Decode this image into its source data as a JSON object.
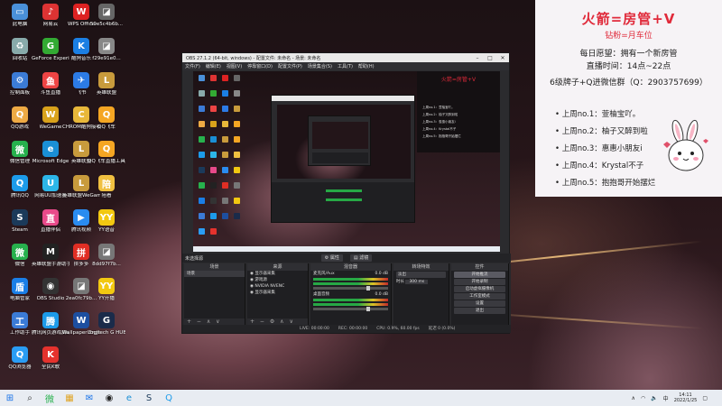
{
  "desktop": {
    "icons": [
      {
        "label": "此电脑",
        "icon": "computer-icon",
        "color": "#4a90d9",
        "glyph": "▭"
      },
      {
        "label": "网易云",
        "icon": "netease-icon",
        "color": "#d33",
        "glyph": "♪"
      },
      {
        "label": "WPS Office",
        "icon": "wps-icon",
        "color": "#d22",
        "glyph": "W"
      },
      {
        "label": "59e5c4b6b...",
        "icon": "file-icon",
        "color": "#666",
        "glyph": "◪"
      },
      {
        "label": "回收站",
        "icon": "recycle-bin-icon",
        "color": "#8aa",
        "glyph": "♻"
      },
      {
        "label": "GeForce Experience",
        "icon": "geforce-icon",
        "color": "#3a3",
        "glyph": "G"
      },
      {
        "label": "酷狗音乐",
        "icon": "kugou-icon",
        "color": "#1b7fe3",
        "glyph": "K"
      },
      {
        "label": "f29e91e0...",
        "icon": "file-icon",
        "color": "#888",
        "glyph": "◪"
      },
      {
        "label": "控制面板",
        "icon": "control-panel-icon",
        "color": "#3b7bd6",
        "glyph": "⚙"
      },
      {
        "label": "斗鱼直播",
        "icon": "douyu-icon",
        "color": "#e44",
        "glyph": "鱼"
      },
      {
        "label": "飞书",
        "icon": "feishu-icon",
        "color": "#2c7be5",
        "glyph": "✈"
      },
      {
        "label": "英雄联盟",
        "icon": "lol-icon",
        "color": "#c89b3c",
        "glyph": "L"
      },
      {
        "label": "QQ游戏",
        "icon": "qqgame-icon",
        "color": "#ea4",
        "glyph": "Q"
      },
      {
        "label": "WeGame",
        "icon": "wegame-icon",
        "color": "#d9a21b",
        "glyph": "W"
      },
      {
        "label": "CHROM酷狗接收工",
        "icon": "app-icon",
        "color": "#e8b83a",
        "glyph": "C"
      },
      {
        "label": "QQ飞车",
        "icon": "qqspeed-icon",
        "color": "#f5a623",
        "glyph": "Q"
      },
      {
        "label": "微信管理",
        "icon": "wechat-icon",
        "color": "#27b14d",
        "glyph": "微"
      },
      {
        "label": "Microsoft Edge",
        "icon": "edge-icon",
        "color": "#1a8fd6",
        "glyph": "e"
      },
      {
        "label": "英雄联盟",
        "icon": "lol-icon",
        "color": "#c89b3c",
        "glyph": "L"
      },
      {
        "label": "QQ飞车直播工具",
        "icon": "qqspeed-icon",
        "color": "#f5a623",
        "glyph": "Q"
      },
      {
        "label": "腾讯QQ",
        "icon": "qq-icon",
        "color": "#1c9bea",
        "glyph": "Q"
      },
      {
        "label": "网易UU加速器",
        "icon": "uu-icon",
        "color": "#2cb6e8",
        "glyph": "U"
      },
      {
        "label": "英雄联盟WeGame版",
        "icon": "lol-icon",
        "color": "#c89b3c",
        "glyph": "L"
      },
      {
        "label": "陪看",
        "icon": "app-icon",
        "color": "#f0c040",
        "glyph": "陪"
      },
      {
        "label": "Steam",
        "icon": "steam-icon",
        "color": "#1b3a5a",
        "glyph": "S"
      },
      {
        "label": "直播伴侣",
        "icon": "live-companion-icon",
        "color": "#e84a8a",
        "glyph": "直"
      },
      {
        "label": "腾讯视频",
        "icon": "tencent-video-icon",
        "color": "#2a8cf0",
        "glyph": "▶"
      },
      {
        "label": "YY语音",
        "icon": "yy-icon",
        "color": "#f2c811",
        "glyph": "YY"
      },
      {
        "label": "微信",
        "icon": "wechat-icon",
        "color": "#27b14d",
        "glyph": "微"
      },
      {
        "label": "英雄联盟手游助手",
        "icon": "app-icon",
        "color": "#222",
        "glyph": "M"
      },
      {
        "label": "拼多多",
        "icon": "app-icon",
        "color": "#e02e24",
        "glyph": "拼"
      },
      {
        "label": "8dd97f7b...",
        "icon": "file-icon",
        "color": "#777",
        "glyph": "◪"
      },
      {
        "label": "电脑管家",
        "icon": "pcmanager-icon",
        "color": "#1a7ee6",
        "glyph": "盾"
      },
      {
        "label": "OBS Studio",
        "icon": "obs-icon",
        "color": "#333",
        "glyph": "◉"
      },
      {
        "label": "2ea0fc79b...",
        "icon": "file-icon",
        "color": "#777",
        "glyph": "◪"
      },
      {
        "label": "YY开播",
        "icon": "yy-icon",
        "color": "#f2c811",
        "glyph": "YY"
      },
      {
        "label": "工作助手",
        "icon": "app-icon",
        "color": "#3b7bd6",
        "glyph": "工"
      },
      {
        "label": "腾讯网页游戏启动器",
        "icon": "app-icon",
        "color": "#1c9bea",
        "glyph": "腾"
      },
      {
        "label": "Wallpaper Engine",
        "icon": "wallpaper-engine-icon",
        "color": "#1d4fa0",
        "glyph": "W"
      },
      {
        "label": "Logitech G HUB",
        "icon": "logitech-icon",
        "color": "#1a2b4a",
        "glyph": "G"
      },
      {
        "label": "QQ浏览器",
        "icon": "qqbrowser-icon",
        "color": "#2a9df4",
        "glyph": "Q"
      },
      {
        "label": "全民K歌",
        "icon": "karaoke-icon",
        "color": "#e5322d",
        "glyph": "K"
      }
    ]
  },
  "overlay": {
    "title": "火箭=房管+V",
    "subtitle": "钻粉=月车位",
    "line1": "每日愿望：拥有一个新房管",
    "line2": "直播时间：14点~22点",
    "line3": "6级牌子+Q进微信群（Q：2903757699）",
    "ranking": [
      "上周no.1：萱柚宝吖。",
      "上周no.2：柚子又醉到啦",
      "上周no.3：惠惠小朋友i",
      "上周no.4：Krystal不子",
      "上周no.5：抱抱哥开始摆烂"
    ]
  },
  "obs": {
    "title": "OBS 27.1.2 (64-bit, windows) - 配置文件: 未命名 - 场景: 未命名",
    "menu": [
      "文件(F)",
      "编辑(E)",
      "视图(V)",
      "停靠窗口(D)",
      "配置文件(P)",
      "场景集合(S)",
      "工具(T)",
      "帮助(H)"
    ],
    "toolbar": {
      "properties": "属性",
      "filters": "滤镜",
      "no_source": "未选择源"
    },
    "docks": {
      "scenes": {
        "header": "场景",
        "items": [
          "场景"
        ]
      },
      "sources": {
        "header": "来源",
        "items": [
          "显示器采集",
          "游戏源",
          "NVIDIA NVENC",
          "显示器采集"
        ]
      },
      "mixer": {
        "header": "混音器",
        "channels": [
          {
            "name": "麦克风/Aux",
            "db": "0.0 dB"
          },
          {
            "name": "桌面音频",
            "db": "0.0 dB"
          }
        ]
      },
      "transitions": {
        "header": "转场特效",
        "type": "淡出",
        "duration_label": "时长",
        "duration": "300 ms"
      },
      "controls": {
        "header": "控件",
        "buttons": [
          "开始推流",
          "开始录制",
          "启动虚拟摄像机",
          "工作室模式",
          "设置",
          "退出"
        ]
      }
    },
    "status": {
      "live": "LIVE: 00:00:00",
      "rec": "REC: 00:00:00",
      "cpu": "CPU: 0.9%, 60.00 fps",
      "dropped": "延迟 0 (0.0%)"
    }
  },
  "taskbar": {
    "time": "14:11",
    "date": "2022/1/25",
    "apps": [
      "start-icon",
      "search-icon",
      "wechat-icon",
      "file-explorer-icon",
      "mail-icon",
      "obs-icon",
      "edge-icon",
      "steam-icon",
      "qq-icon"
    ]
  }
}
